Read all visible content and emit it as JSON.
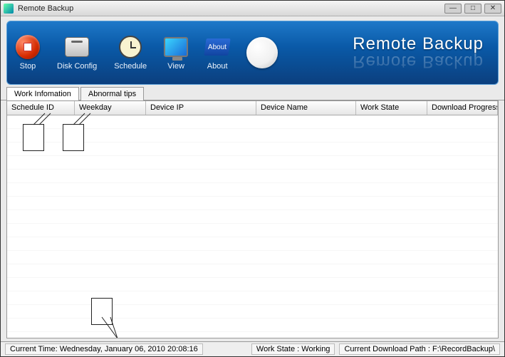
{
  "window": {
    "title": "Remote Backup"
  },
  "brand": {
    "name": "Remote Backup"
  },
  "toolbar": {
    "stop": "Stop",
    "disk_config": "Disk Config",
    "schedule": "Schedule",
    "view": "View",
    "about": "About",
    "about_badge": "About"
  },
  "tabs": [
    {
      "label": "Work Infomation",
      "active": true
    },
    {
      "label": "Abnormal tips",
      "active": false
    }
  ],
  "columns": [
    "Schedule ID",
    "Weekday",
    "Device IP",
    "Device Name",
    "Work State",
    "Download Progress"
  ],
  "rows": [],
  "status": {
    "current_time_label": "Current Time:",
    "current_time_value": "Wednesday, January 06, 2010  20:08:16",
    "work_state_label": "Work State :",
    "work_state_value": "Working",
    "download_path_label": "Current Download Path :",
    "download_path_value": "F:\\RecordBackup\\"
  }
}
